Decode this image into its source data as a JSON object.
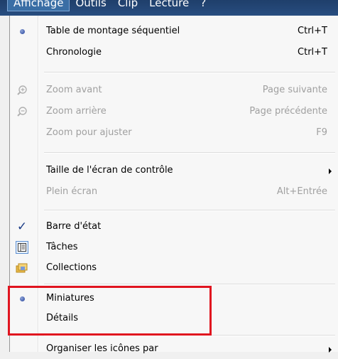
{
  "menubar": {
    "items": [
      "Affichage",
      "Outils",
      "Clip",
      "Lecture",
      "?"
    ]
  },
  "menu": {
    "items": [
      {
        "label": "Table de montage séquentiel",
        "shortcut": "Ctrl+T"
      },
      {
        "label": "Chronologie",
        "shortcut": "Ctrl+T"
      },
      {
        "label": "Zoom avant",
        "shortcut": "Page suivante"
      },
      {
        "label": "Zoom arrière",
        "shortcut": "Page précédente"
      },
      {
        "label": "Zoom pour ajuster",
        "shortcut": "F9"
      },
      {
        "label": "Taille de l'écran de contrôle",
        "shortcut": ""
      },
      {
        "label": "Plein écran",
        "shortcut": "Alt+Entrée"
      },
      {
        "label": "Barre d'état",
        "shortcut": ""
      },
      {
        "label": "Tâches",
        "shortcut": ""
      },
      {
        "label": "Collections",
        "shortcut": ""
      },
      {
        "label": "Miniatures",
        "shortcut": ""
      },
      {
        "label": "Détails",
        "shortcut": ""
      },
      {
        "label": "Organiser les icônes par",
        "shortcut": ""
      }
    ]
  },
  "colors": {
    "highlight_box": "#e0141f",
    "menu_background": "#f7f7f7",
    "disabled_text": "#a0a0a0"
  }
}
